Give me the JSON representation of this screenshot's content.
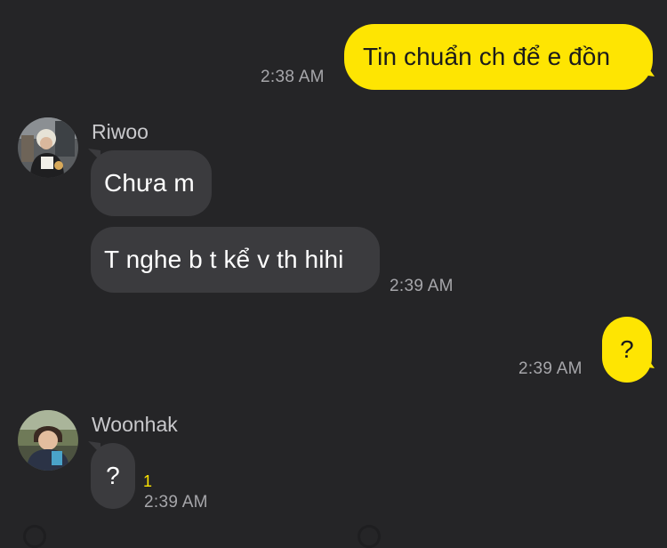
{
  "messages": {
    "out1": {
      "text": "Tin chuẩn ch để e đồn",
      "time": "2:38 AM"
    },
    "riwoo": {
      "name": "Riwoo",
      "bubble1": "Chưa m",
      "bubble2": "T nghe b t kể v th hihi",
      "time": "2:39 AM"
    },
    "out2": {
      "text": "?",
      "time": "2:39 AM"
    },
    "woonhak": {
      "name": "Woonhak",
      "bubble1": "?",
      "unread": "1",
      "time": "2:39 AM"
    }
  },
  "colors": {
    "background": "#252527",
    "outgoing_bubble": "#fee502",
    "incoming_bubble": "#3b3b3e",
    "unread_count": "#fee502",
    "timestamp": "#a6a6aa"
  },
  "icons": {
    "riwoo_avatar": "avatar-photo",
    "woonhak_avatar": "avatar-photo"
  }
}
